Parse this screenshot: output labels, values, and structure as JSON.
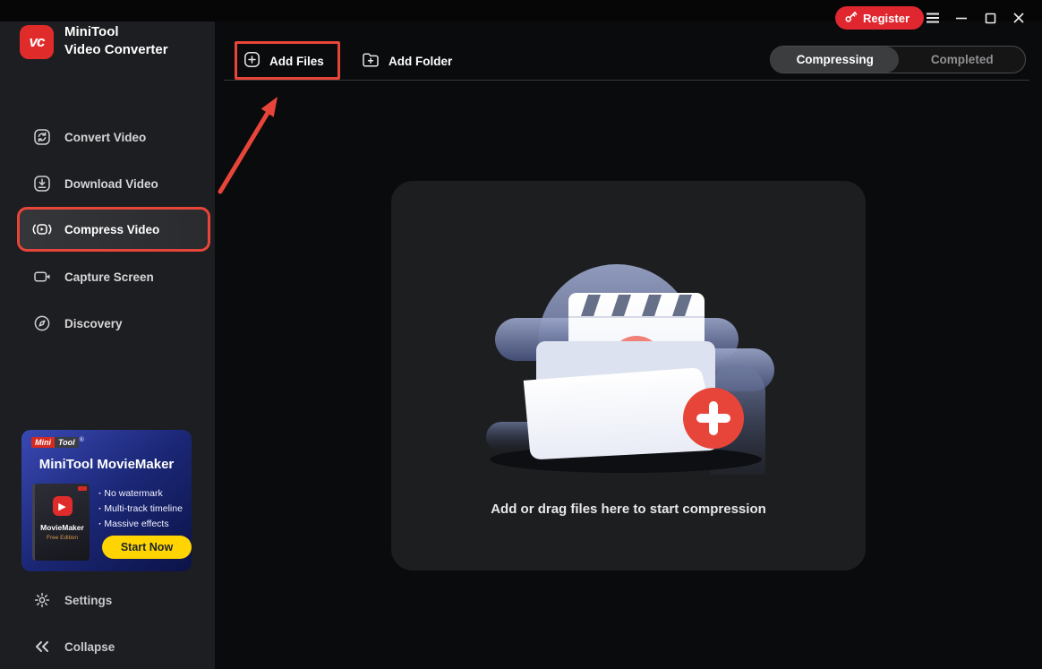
{
  "app": {
    "name_line1": "MiniTool",
    "name_line2": "Video Converter",
    "logo_glyph": "vc"
  },
  "titlebar": {
    "register": "Register"
  },
  "sidebar": {
    "items": [
      {
        "label": "Convert Video"
      },
      {
        "label": "Download Video"
      },
      {
        "label": "Compress Video",
        "selected": true
      },
      {
        "label": "Capture Screen"
      },
      {
        "label": "Discovery"
      }
    ],
    "settings": "Settings",
    "collapse": "Collapse"
  },
  "promo": {
    "brand_left": "Mini",
    "brand_right": "Tool",
    "reg_mark": "®",
    "title": "MiniTool MovieMaker",
    "bullets": [
      "No watermark",
      "Multi-track timeline",
      "Massive effects"
    ],
    "cta": "Start Now",
    "box_name": "MovieMaker",
    "box_edition": "Free Edition",
    "box_icon_glyph": "▶"
  },
  "toolbar": {
    "add_files": "Add Files",
    "add_folder": "Add Folder"
  },
  "tabs": {
    "items": [
      "Compressing",
      "Completed"
    ],
    "active": "Compressing"
  },
  "dropzone": {
    "hint": "Add or drag files here to start compression"
  },
  "colors": {
    "annotation_red": "#e8453a",
    "register_red": "#e02730",
    "brand_red": "#e02b2b",
    "cta_yellow": "#ffd400",
    "sidebar_bg": "#1d1e21",
    "main_bg": "#0a0b0d",
    "dropzone_bg": "#1d1e20",
    "promo_blue_top": "#3a49b4",
    "promo_blue_bottom": "#0b1347"
  }
}
